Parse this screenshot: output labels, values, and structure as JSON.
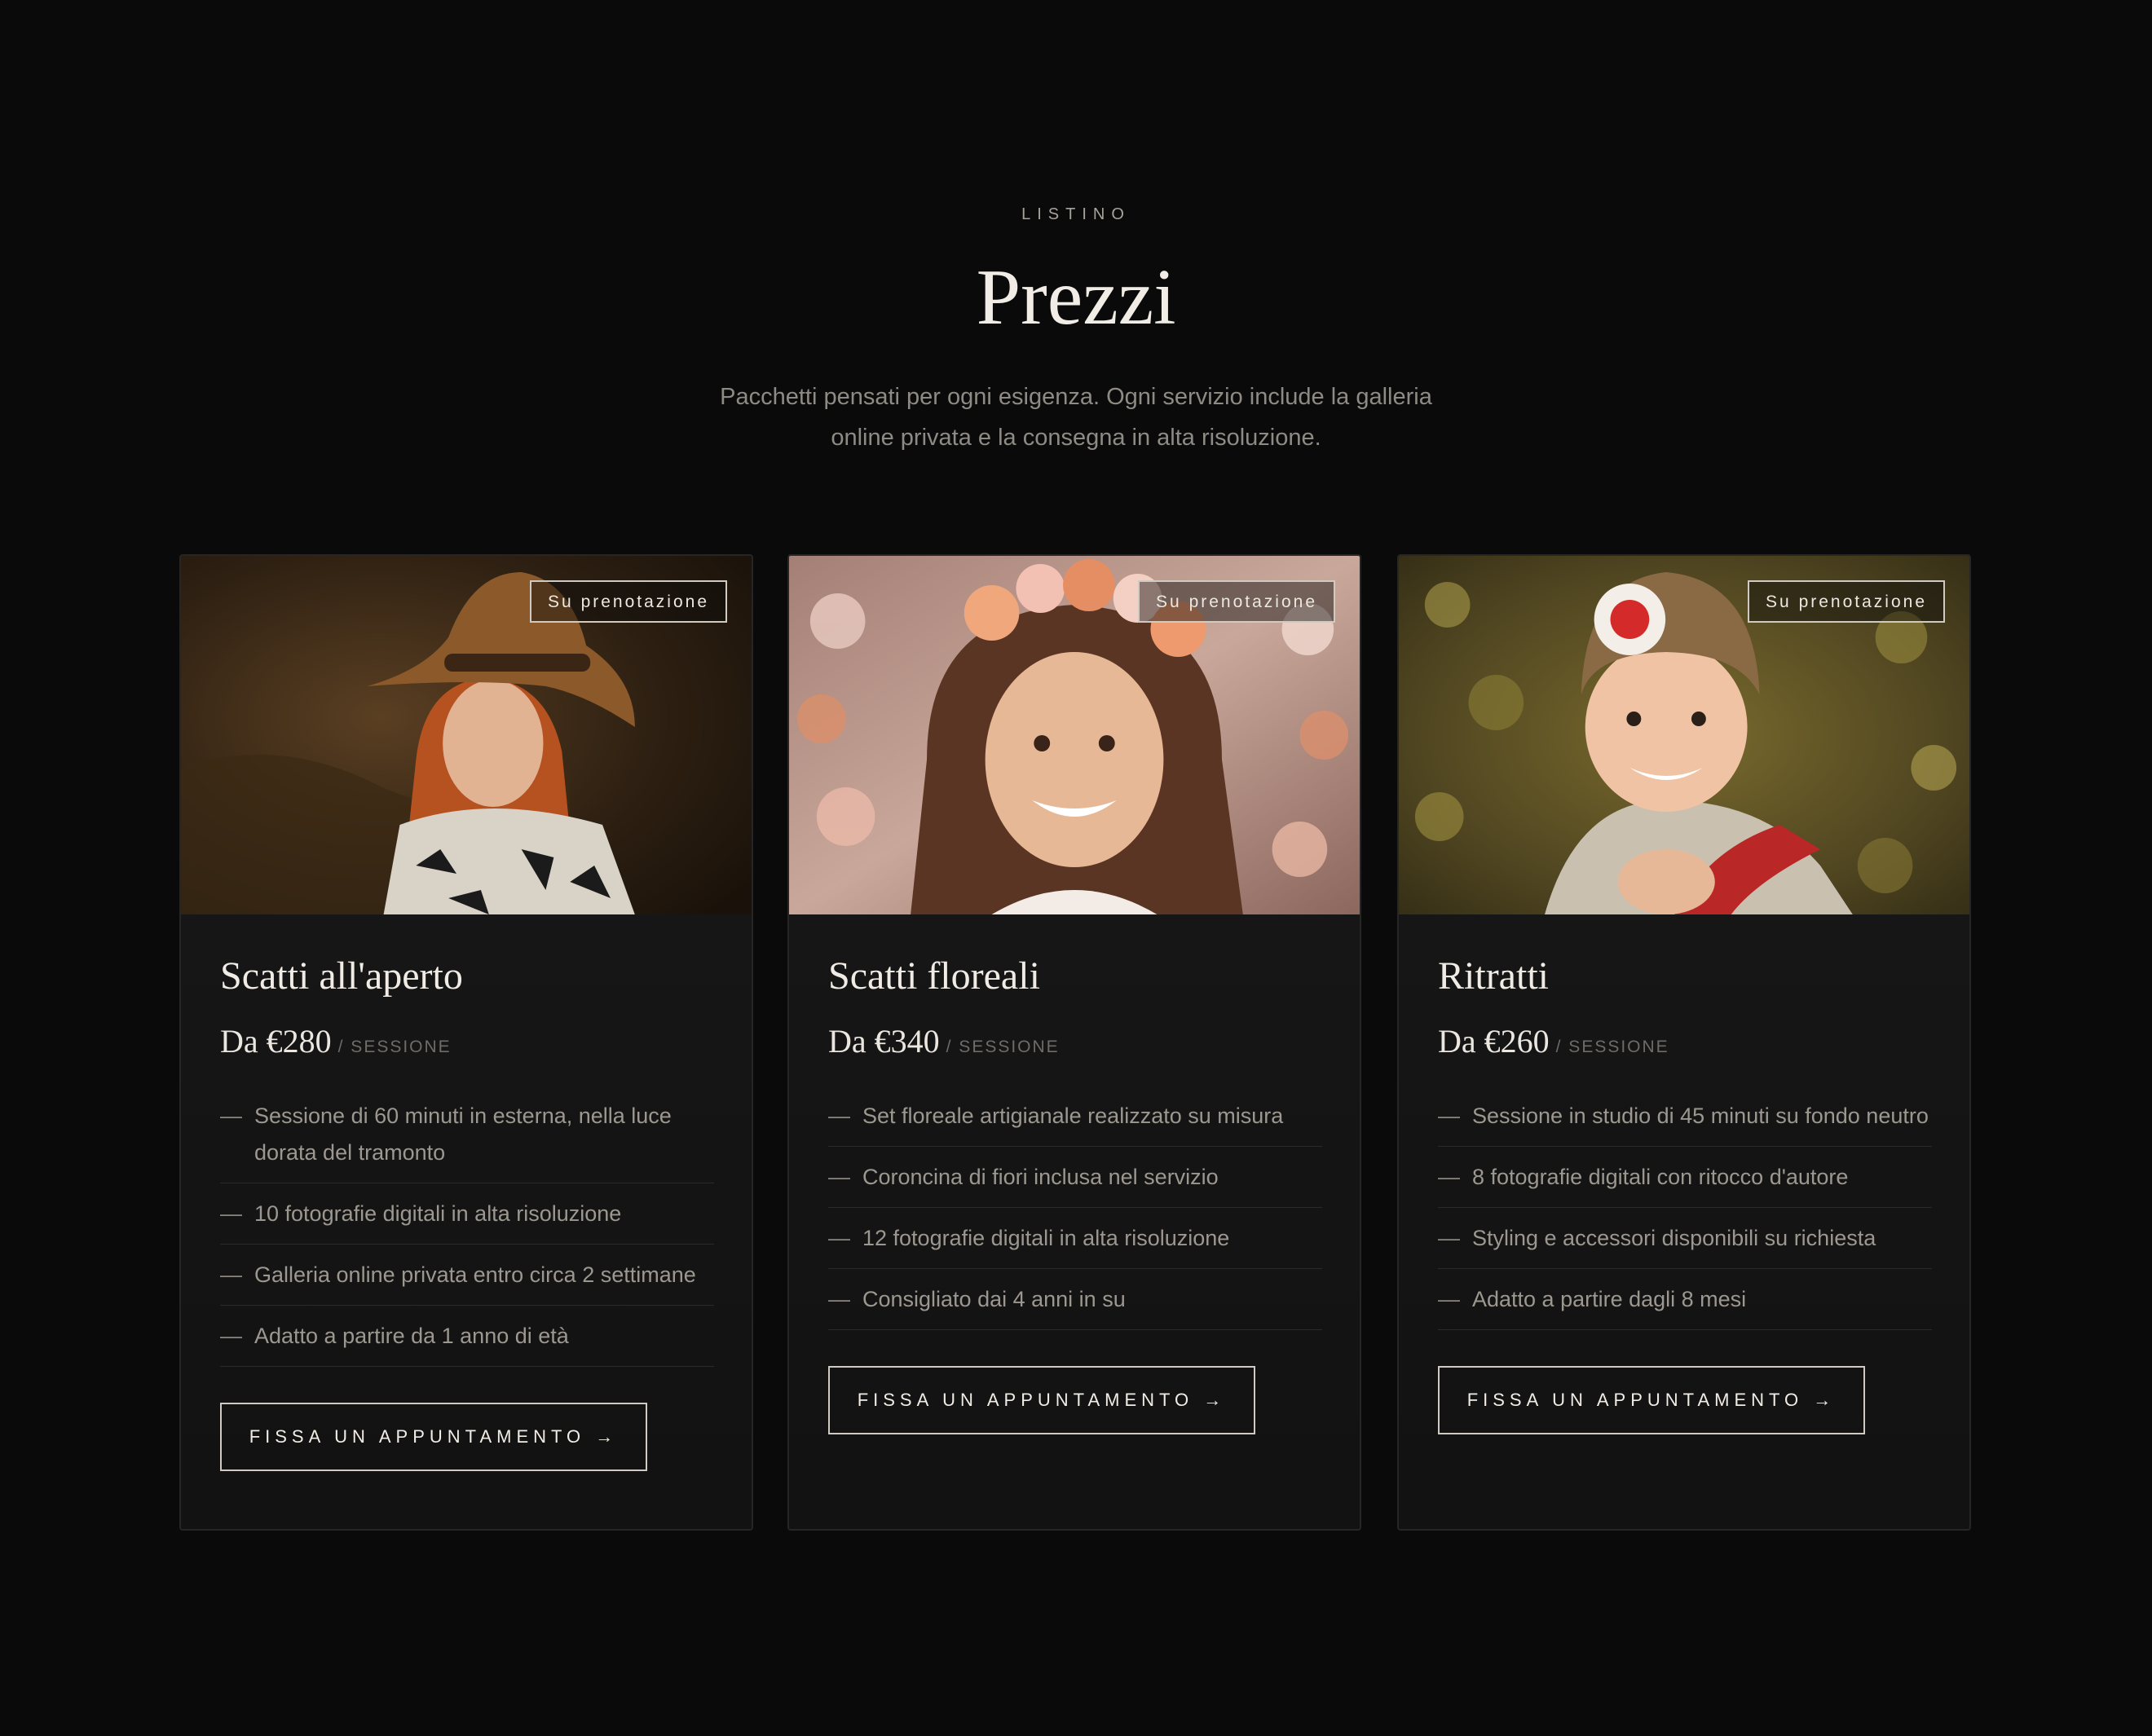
{
  "header": {
    "eyebrow": "LISTINO",
    "title": "Prezzi",
    "intro": "Pacchetti pensati per ogni esigenza. Ogni servizio include la galleria online privata e la consegna in alta risoluzione."
  },
  "cards": [
    {
      "badge": "Su prenotazione",
      "title": "Scatti all'aperto",
      "price": "Da €280",
      "unit": "/ SESSIONE",
      "features": [
        "Sessione di 60 minuti in esterna, nella luce dorata del tramonto",
        "10 fotografie digitali in alta risoluzione",
        "Galleria online privata entro circa 2 settimane",
        "Adatto a partire da 1 anno di età"
      ],
      "cta": "FISSA UN APPUNTAMENTO →"
    },
    {
      "badge": "Su prenotazione",
      "title": "Scatti floreali",
      "price": "Da €340",
      "unit": "/ SESSIONE",
      "features": [
        "Set floreale artigianale realizzato su misura",
        "Coroncina di fiori inclusa nel servizio",
        "12 fotografie digitali in alta risoluzione",
        "Consigliato dai 4 anni in su"
      ],
      "cta": "FISSA UN APPUNTAMENTO →"
    },
    {
      "badge": "Su prenotazione",
      "title": "Ritratti",
      "price": "Da €260",
      "unit": "/ SESSIONE",
      "features": [
        "Sessione in studio di 45 minuti su fondo neutro",
        "8 fotografie digitali con ritocco d'autore",
        "Styling e accessori disponibili su richiesta",
        "Adatto a partire dagli 8 mesi"
      ],
      "cta": "FISSA UN APPUNTAMENTO →"
    }
  ],
  "colors": {
    "background": "#0a0a0a",
    "card": "#161616",
    "text": "#f0ece5",
    "muted": "#9c9890"
  }
}
